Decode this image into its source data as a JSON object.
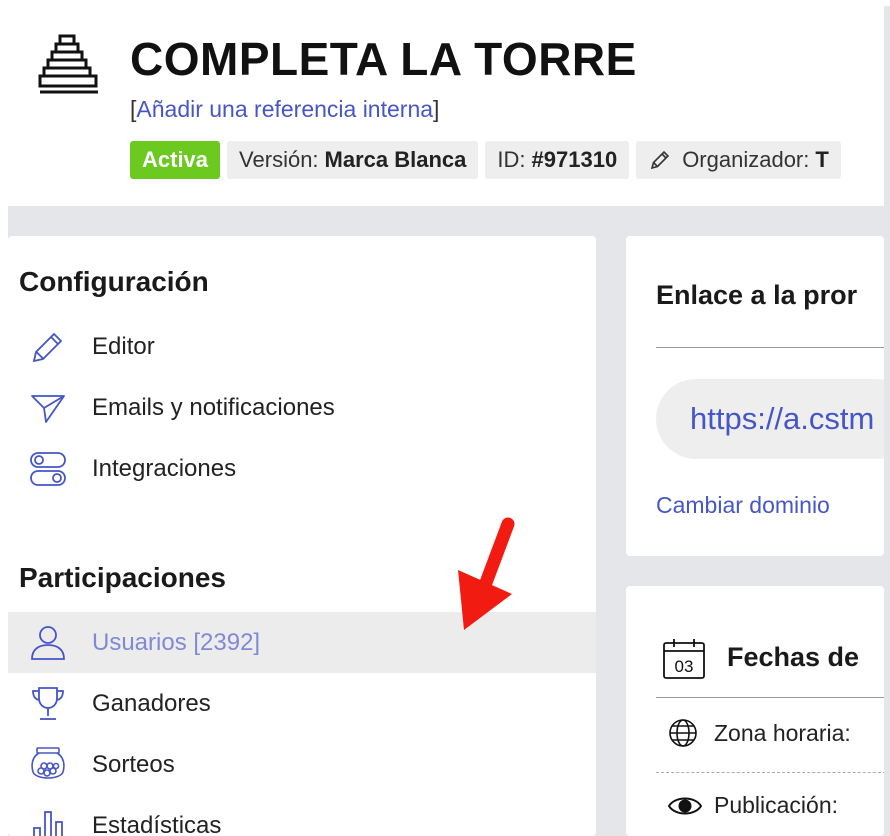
{
  "header": {
    "title": "COMPLETA LA TORRE",
    "ref_open": "[",
    "ref_link": "Añadir una referencia interna",
    "ref_close": "]",
    "status": "Activa",
    "version_label": "Versión:",
    "version_value": "Marca Blanca",
    "id_label": "ID:",
    "id_value": "#971310",
    "organizer_label": "Organizador:",
    "organizer_value": "T"
  },
  "sidebar": {
    "config_title": "Configuración",
    "config_items": [
      {
        "label": "Editor",
        "icon": "pencil-icon"
      },
      {
        "label": "Emails y notificaciones",
        "icon": "paper-plane-icon"
      },
      {
        "label": "Integraciones",
        "icon": "toggles-icon"
      }
    ],
    "participations_title": "Participaciones",
    "participation_items": [
      {
        "label": "Usuarios [2392]",
        "icon": "user-icon",
        "selected": true
      },
      {
        "label": "Ganadores",
        "icon": "trophy-icon"
      },
      {
        "label": "Sorteos",
        "icon": "lottery-bowl-icon"
      },
      {
        "label": "Estadísticas",
        "icon": "bar-chart-icon"
      }
    ]
  },
  "link_card": {
    "title": "Enlace a la pror",
    "url": "https://a.cstm",
    "change_domain": "Cambiar dominio"
  },
  "dates_card": {
    "calendar_day": "03",
    "title": "Fechas de",
    "timezone_label": "Zona horaria:",
    "publication_label": "Publicación:"
  },
  "colors": {
    "accent": "#4656c6",
    "active_badge": "#6cc91f",
    "selected_text": "#8189d6",
    "annotation_arrow": "#f21b12"
  }
}
